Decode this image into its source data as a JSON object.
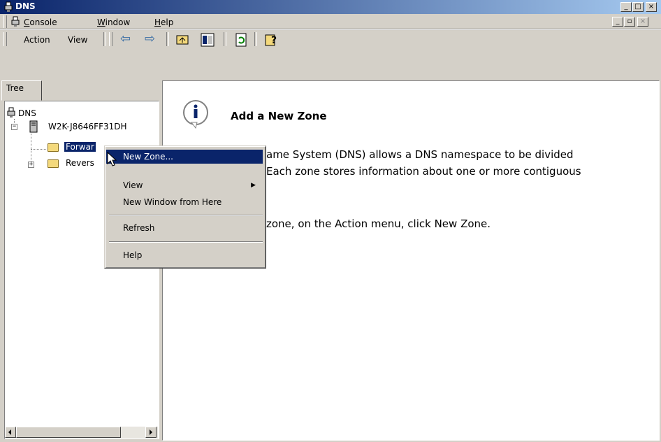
{
  "window": {
    "title": "DNS",
    "controls": {
      "minimize": "_",
      "maximize": "□",
      "close": "×"
    },
    "child_controls": {
      "minimize": "_",
      "restore": "▫",
      "close": "×"
    }
  },
  "menubar": {
    "items": [
      {
        "label": "Console",
        "key": "C"
      },
      {
        "label": "Window",
        "key": "W"
      },
      {
        "label": "Help",
        "key": "H"
      }
    ]
  },
  "toolbar": {
    "action_label": "Action",
    "view_label": "View",
    "back_glyph": "⇦",
    "forward_glyph": "⇨"
  },
  "tree": {
    "tab_label": "Tree",
    "root": "DNS",
    "server": "W2K-J8646FF31DH",
    "forward_zone": "Forwar",
    "reverse_zone": "Revers"
  },
  "context_menu": {
    "items": [
      "New Zone...",
      "View",
      "New Window from Here",
      "Refresh",
      "Help"
    ],
    "submenu_glyph": "▶"
  },
  "details": {
    "heading": "Add a New Zone",
    "paragraph_line1": "ame System (DNS) allows a DNS namespace to be divided",
    "paragraph_line2": "Each zone stores information about one or more contiguous",
    "instruction": "zone, on the Action menu, click New Zone."
  },
  "icons": [
    "dns-console-icon",
    "back-arrow-icon",
    "forward-arrow-icon",
    "up-level-icon",
    "show-hide-tree-icon",
    "refresh-icon",
    "help-icon",
    "info-icon",
    "folder-icon",
    "server-icon",
    "mouse-cursor-icon"
  ],
  "colors": {
    "title_gradient_start": "#0a246a",
    "title_gradient_end": "#a6caf0",
    "selection": "#0a246a",
    "face": "#d4d0c8"
  }
}
